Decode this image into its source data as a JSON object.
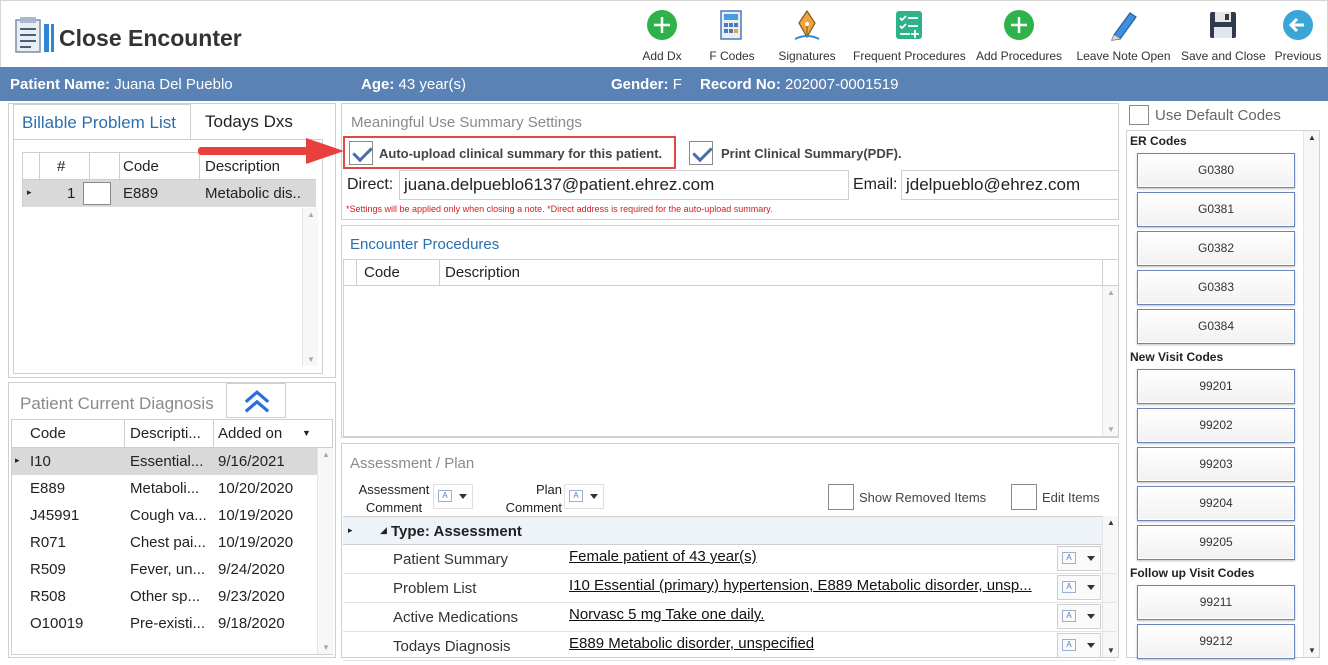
{
  "header": {
    "title": "Close Encounter",
    "toolbar": [
      {
        "label": "Add Dx",
        "icon": "add-circle-icon"
      },
      {
        "label": "F Codes",
        "icon": "calculator-icon"
      },
      {
        "label": "Signatures",
        "icon": "pen-nib-icon"
      },
      {
        "label": "Frequent Procedures",
        "icon": "checklist-icon"
      },
      {
        "label": "Add Procedures",
        "icon": "add-circle-icon"
      },
      {
        "label": "Leave Note Open",
        "icon": "pencil-icon"
      },
      {
        "label": "Save and Close",
        "icon": "floppy-disk-icon"
      },
      {
        "label": "Previous",
        "icon": "back-arrow-icon"
      }
    ]
  },
  "patient": {
    "name_label": "Patient Name:",
    "name": "Juana Del Pueblo",
    "age_label": "Age:",
    "age": "43 year(s)",
    "gender_label": "Gender:",
    "gender": "F",
    "record_label": "Record No:",
    "record": "202007-0001519"
  },
  "problems": {
    "tab_billable": "Billable Problem List",
    "tab_todays": "Todays Dxs",
    "columns": [
      "#",
      "Code",
      "Description"
    ],
    "rows": [
      {
        "num": "1",
        "code": "E889",
        "desc": "Metabolic dis..."
      }
    ]
  },
  "current_dx": {
    "title": "Patient Current Diagnosis",
    "columns": [
      "Code",
      "Descripti...",
      "Added on"
    ],
    "rows": [
      {
        "code": "I10",
        "desc": "Essential...",
        "date": "9/16/2021"
      },
      {
        "code": "E889",
        "desc": "Metaboli...",
        "date": "10/20/2020"
      },
      {
        "code": "J45991",
        "desc": "Cough va...",
        "date": "10/19/2020"
      },
      {
        "code": "R071",
        "desc": "Chest pai...",
        "date": "10/19/2020"
      },
      {
        "code": "R509",
        "desc": "Fever, un...",
        "date": "9/24/2020"
      },
      {
        "code": "R508",
        "desc": "Other sp...",
        "date": "9/23/2020"
      },
      {
        "code": "O10019",
        "desc": "Pre-existi...",
        "date": "9/18/2020"
      }
    ]
  },
  "mu": {
    "title": "Meaningful Use Summary Settings",
    "auto_upload_label": "Auto-upload clinical summary for this patient.",
    "print_label": "Print Clinical Summary(PDF).",
    "direct_label": "Direct:",
    "direct_value": "juana.delpueblo6137@patient.ehrez.com",
    "email_label": "Email:",
    "email_value": "jdelpueblo@ehrez.com",
    "note": "*Settings will be applied only when closing a note.   *Direct address is required for the auto-upload summary."
  },
  "procedures": {
    "title": "Encounter Procedures",
    "columns": [
      "Code",
      "Description"
    ]
  },
  "assessment": {
    "title": "Assessment / Plan",
    "assessment_comment": "Assessment Comment",
    "assessment_comment_l1": "Assessment",
    "assessment_comment_l2": "Comment",
    "plan_comment_l1": "Plan",
    "plan_comment_l2": "Comment",
    "show_removed": "Show Removed Items",
    "edit_items": "Edit Items",
    "group_label": "Type: Assessment",
    "rows": [
      {
        "label": "Patient Summary",
        "value": "Female patient of 43 year(s)"
      },
      {
        "label": "Problem List",
        "value": "I10 Essential (primary) hypertension, E889 Metabolic disorder, unsp..."
      },
      {
        "label": "Active Medications",
        "value": "Norvasc 5 mg Take one daily. "
      },
      {
        "label": "Todays Diagnosis",
        "value": " E889 Metabolic disorder, unspecified"
      }
    ]
  },
  "codes": {
    "use_default": "Use Default Codes",
    "groups": [
      {
        "title": "ER Codes",
        "codes": [
          "G0380",
          "G0381",
          "G0382",
          "G0383",
          "G0384"
        ]
      },
      {
        "title": "New Visit Codes",
        "codes": [
          "99201",
          "99202",
          "99203",
          "99204",
          "99205"
        ]
      },
      {
        "title": "Follow up Visit Codes",
        "codes": [
          "99211",
          "99212"
        ]
      }
    ]
  }
}
